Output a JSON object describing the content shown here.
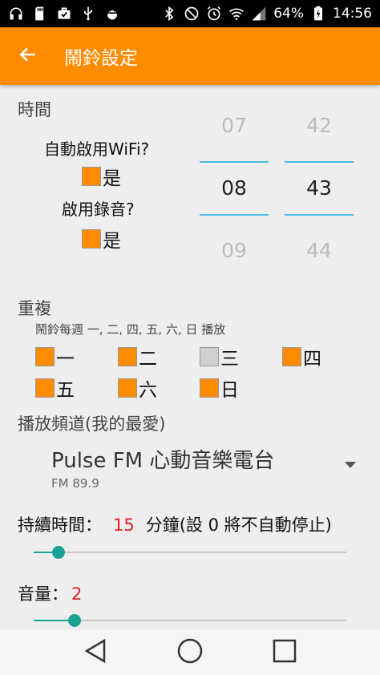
{
  "status_bar": {
    "battery_percent": "64%",
    "time": "14:56",
    "left_icons": [
      "headphones-icon",
      "sd-card-icon",
      "briefcase-check-icon",
      "usb-icon",
      "android-debug-icon"
    ],
    "right_icons": [
      "bluetooth-icon",
      "mute-icon",
      "alarm-icon",
      "wifi-icon",
      "signal-icon",
      "battery-charging-icon"
    ]
  },
  "app_bar": {
    "title": "鬧鈴設定",
    "color": "#ff8c00"
  },
  "time_section": {
    "label": "時間",
    "hours": [
      "07",
      "08",
      "09"
    ],
    "minutes": [
      "42",
      "43",
      "44"
    ],
    "wifi_question": "自動啟用WiFi?",
    "wifi_answer": "是",
    "record_question": "啟用錄音?",
    "record_answer": "是"
  },
  "repeat_section": {
    "label": "重複",
    "summary": "鬧鈴每週 一, 二, 四, 五, 六, 日 播放",
    "days": [
      {
        "label": "一",
        "checked": true
      },
      {
        "label": "二",
        "checked": true
      },
      {
        "label": "三",
        "checked": false
      },
      {
        "label": "四",
        "checked": true
      },
      {
        "label": "五",
        "checked": true
      },
      {
        "label": "六",
        "checked": true
      },
      {
        "label": "日",
        "checked": true
      }
    ]
  },
  "channel_section": {
    "label": "播放頻道(我的最愛)",
    "selected_name": "Pulse FM 心動音樂電台",
    "selected_freq": "FM 89.9"
  },
  "duration": {
    "label": "持續時間：",
    "value": "15",
    "unit_note": "分鐘(設 0 將不自動停止)",
    "slider_fraction": 0.08
  },
  "volume": {
    "label": "音量：",
    "value": "2",
    "slider_fraction": 0.13
  },
  "nav_bar": {
    "buttons": [
      "back-triangle-icon",
      "home-circle-icon",
      "recents-square-icon"
    ]
  }
}
